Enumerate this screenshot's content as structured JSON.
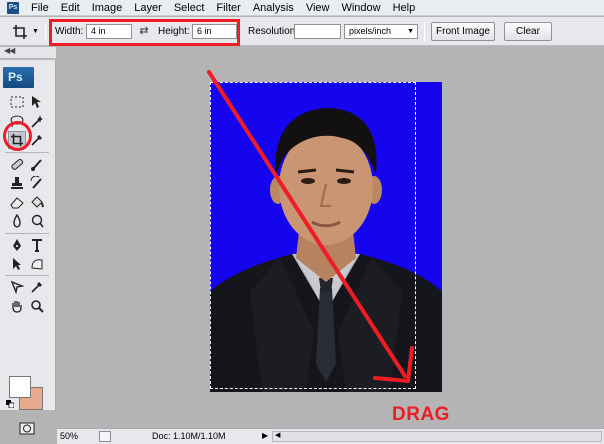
{
  "app_icon_label": "Ps",
  "menu": [
    "File",
    "Edit",
    "Image",
    "Layer",
    "Select",
    "Filter",
    "Analysis",
    "View",
    "Window",
    "Help"
  ],
  "options": {
    "width_label": "Width:",
    "width_value": "4 in",
    "height_label": "Height:",
    "height_value": "6 in",
    "resolution_label": "Resolution:",
    "resolution_value": "",
    "resolution_unit": "pixels/inch",
    "front_image_button": "Front Image",
    "clear_button": "Clear"
  },
  "toolbox": {
    "logo": "Ps",
    "collapse_glyph": "◀◀",
    "active_tool": "crop-tool",
    "foreground_color": "#ffffff",
    "background_color": "#e8a98f"
  },
  "annotation": {
    "drag_label": "DRAG",
    "highlight_color": "#ee1c24"
  },
  "canvas": {
    "photo_background_color": "#1505ee"
  },
  "status": {
    "zoom": "50%",
    "doc_info": "Doc: 1.10M/1.10M"
  }
}
